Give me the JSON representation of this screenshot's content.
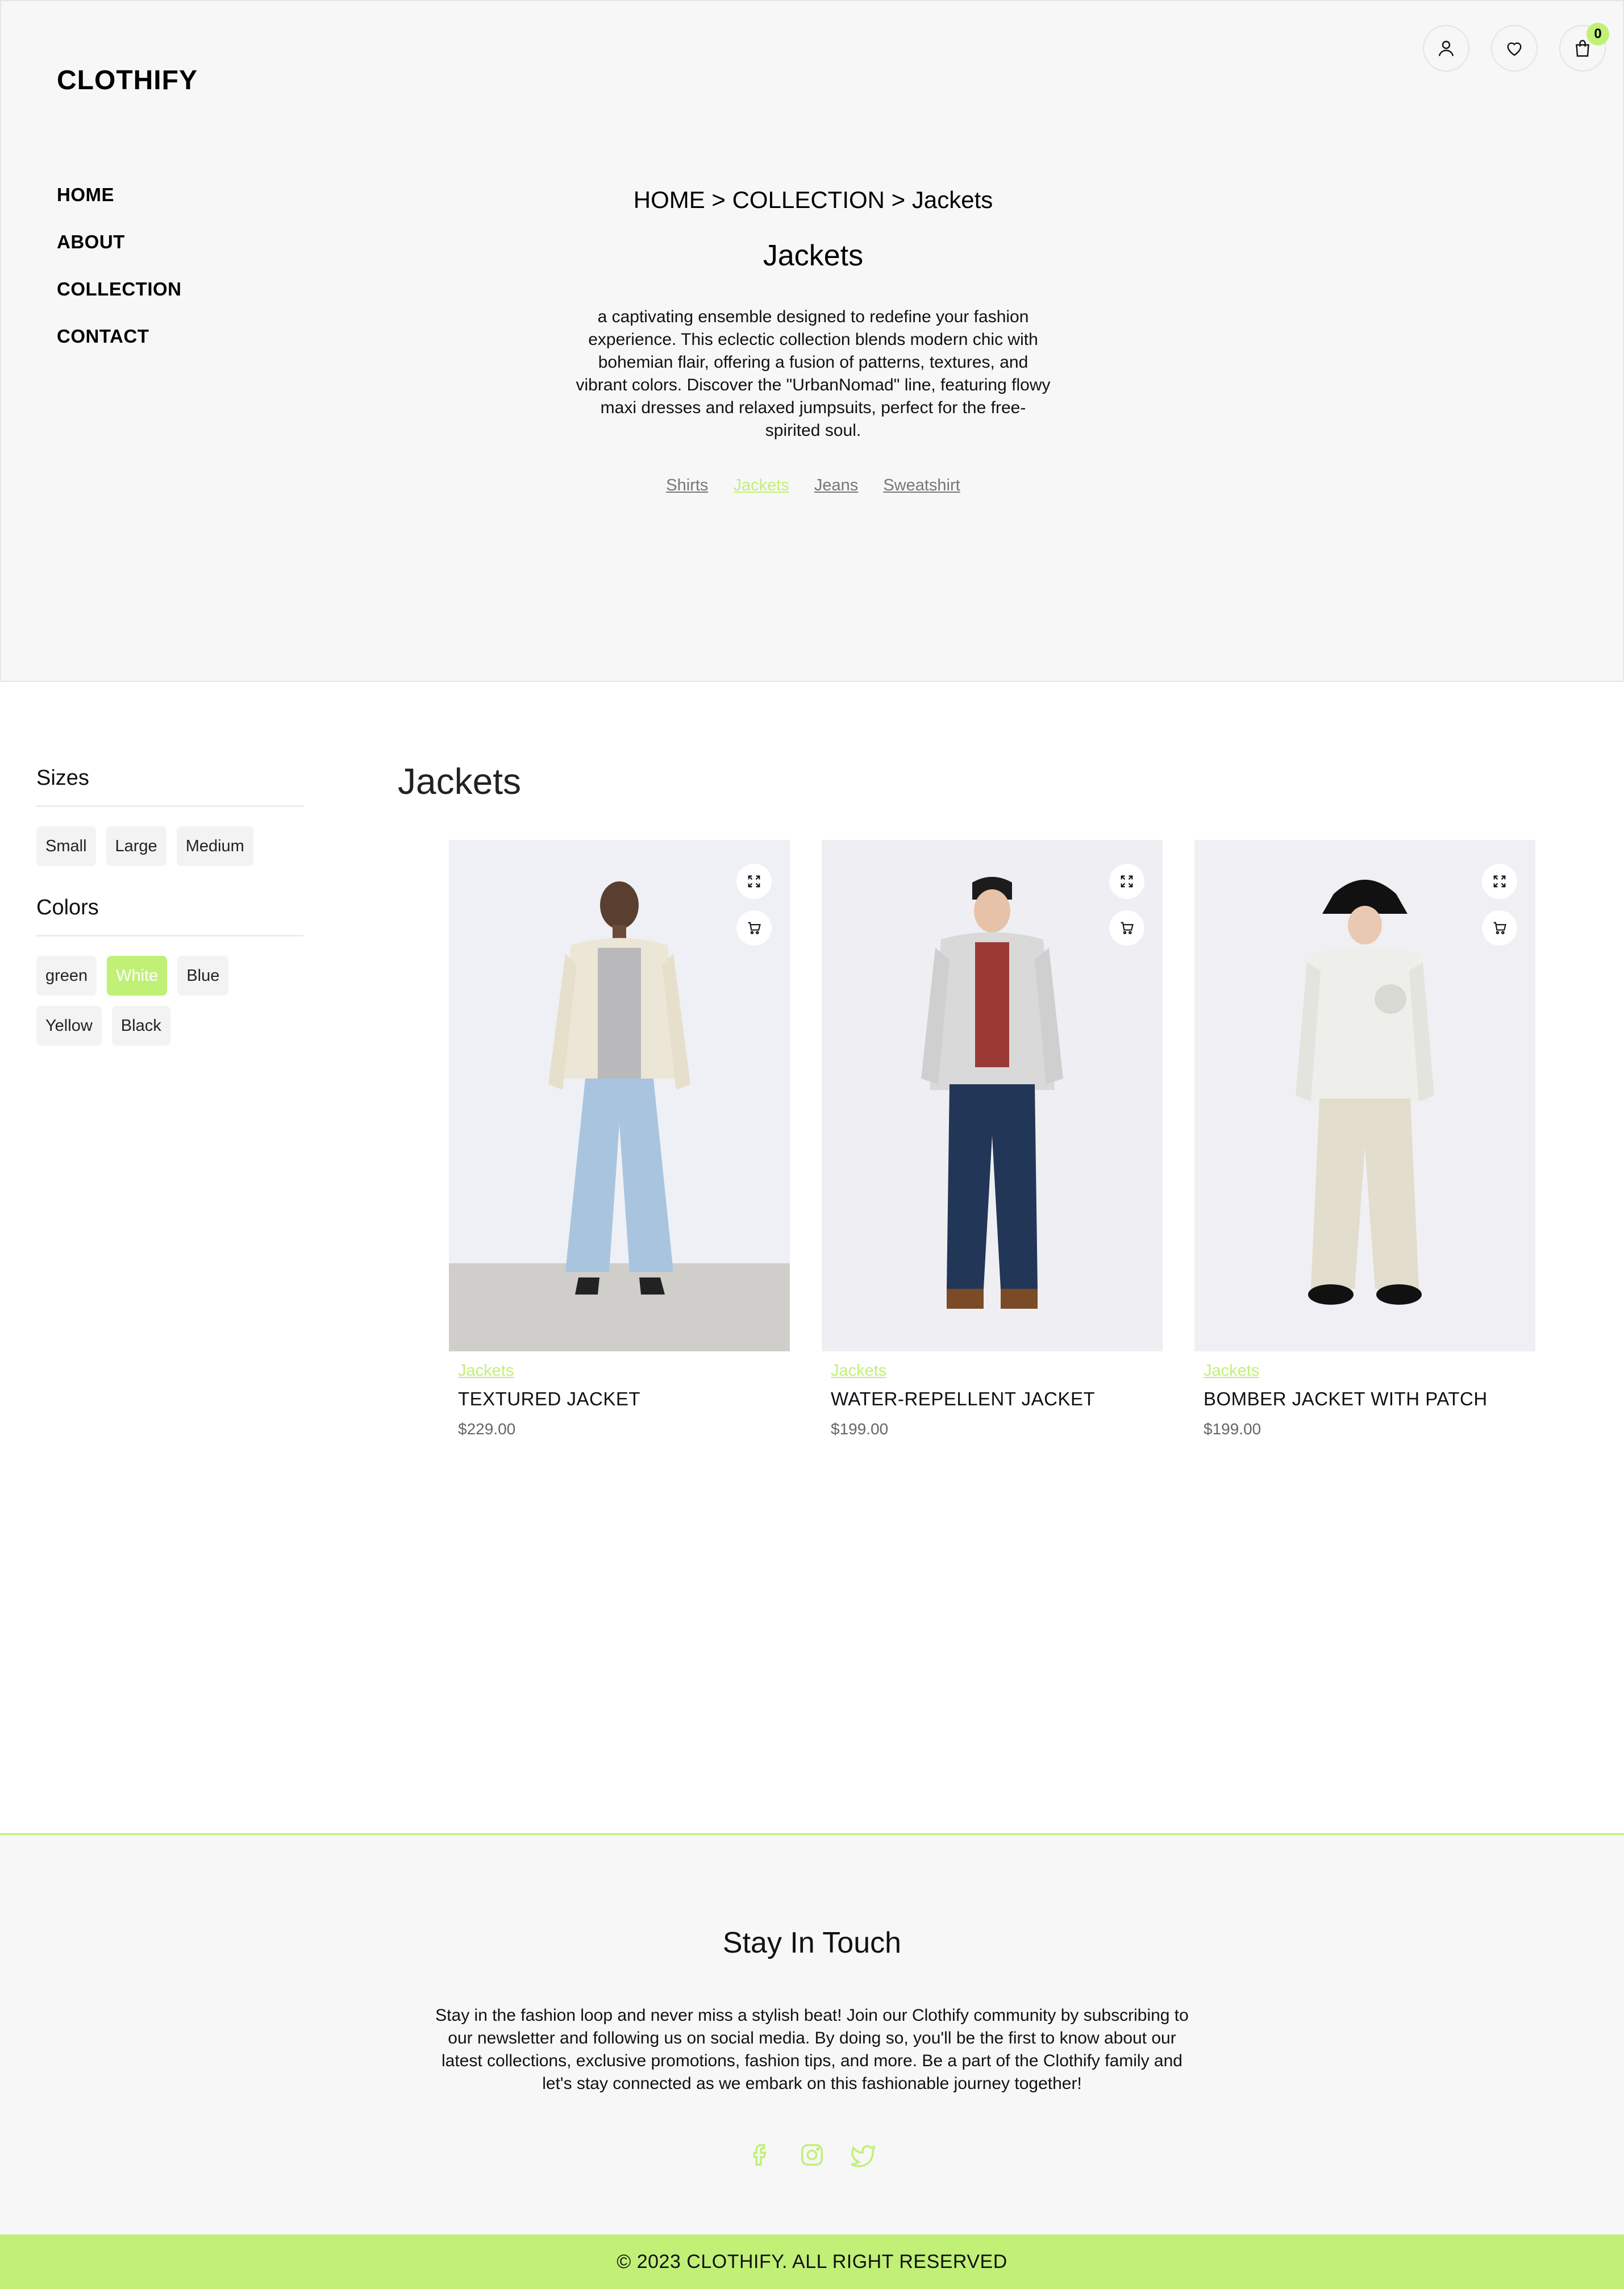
{
  "brand": {
    "logo": "CLOTHIFY"
  },
  "nav": {
    "items": [
      {
        "label": "HOME"
      },
      {
        "label": "ABOUT"
      },
      {
        "label": "COLLECTION"
      },
      {
        "label": "CONTACT"
      }
    ]
  },
  "header": {
    "cart_count": "0"
  },
  "hero": {
    "breadcrumb": "HOME > COLLECTION > Jackets",
    "title": "Jackets",
    "description": "a captivating ensemble designed to redefine your fashion experience. This eclectic collection blends modern chic with bohemian flair, offering a fusion of patterns, textures, and vibrant colors. Discover the \"UrbanNomad\" line, featuring flowy maxi dresses and relaxed jumpsuits, perfect for the free-spirited soul.",
    "categories": [
      {
        "label": "Shirts",
        "active": false
      },
      {
        "label": "Jackets",
        "active": true
      },
      {
        "label": "Jeans",
        "active": false
      },
      {
        "label": "Sweatshirt",
        "active": false
      }
    ]
  },
  "filters": {
    "sizes_title": "Sizes",
    "sizes": [
      "Small",
      "Large",
      "Medium"
    ],
    "colors_title": "Colors",
    "colors": [
      "green",
      "White",
      "Blue",
      "Yellow",
      "Black"
    ],
    "selected_color": "White"
  },
  "products_section": {
    "title": "Jackets"
  },
  "products": [
    {
      "category": "Jackets",
      "name": "TEXTURED JACKET",
      "price": "$229.00"
    },
    {
      "category": "Jackets",
      "name": "WATER-REPELLENT JACKET",
      "price": "$199.00"
    },
    {
      "category": "Jackets",
      "name": "BOMBER JACKET WITH PATCH",
      "price": "$199.00"
    }
  ],
  "footer": {
    "title": "Stay In Touch",
    "text": "Stay in the fashion loop and never miss a stylish beat! Join our Clothify community by subscribing to our newsletter and following us on social media. By doing so, you'll be the first to know about our latest collections, exclusive promotions, fashion tips, and more. Be a part of the Clothify family and let's stay connected as we embark on this fashionable journey together!",
    "socials": [
      "facebook-icon",
      "instagram-icon",
      "twitter-icon"
    ],
    "copyright": "© 2023 CLOTHIFY. ALL RIGHT RESERVED"
  },
  "colors": {
    "accent": "#c1f077",
    "background": "#f7f7f7"
  }
}
